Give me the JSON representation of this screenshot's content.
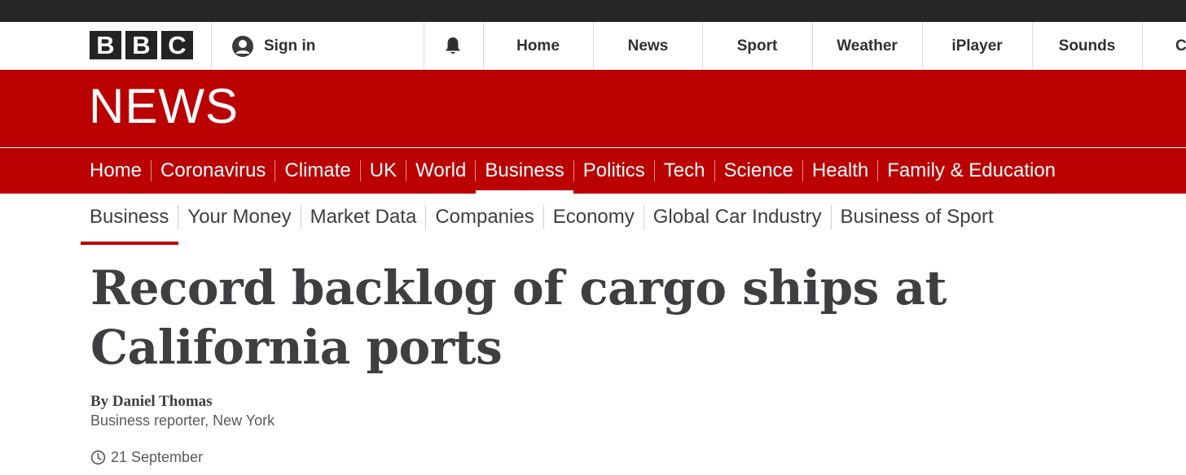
{
  "global_nav": {
    "logo_letters": [
      "B",
      "B",
      "C"
    ],
    "sign_in_label": "Sign in",
    "items": [
      "Home",
      "News",
      "Sport",
      "Weather",
      "iPlayer",
      "Sounds",
      "C"
    ]
  },
  "masthead": {
    "wordmark": "NEWS"
  },
  "section_nav": {
    "items": [
      "Home",
      "Coronavirus",
      "Climate",
      "UK",
      "World",
      "Business",
      "Politics",
      "Tech",
      "Science",
      "Health",
      "Family & Education"
    ],
    "active": "Business"
  },
  "sub_nav": {
    "items": [
      "Business",
      "Your Money",
      "Market Data",
      "Companies",
      "Economy",
      "Global Car Industry",
      "Business of Sport"
    ],
    "active": "Business"
  },
  "article": {
    "headline_line1": "Record backlog of cargo ships at",
    "headline_line2": "California ports",
    "author": "By Daniel Thomas",
    "role": "Business reporter, New York",
    "date": "21 September"
  },
  "colors": {
    "brand_red": "#bb0000",
    "top_strip": "#262626",
    "logo_block": "#232323"
  },
  "icons": {
    "sign_in": "user-avatar-icon",
    "notifications": "bell-icon",
    "date": "clock-icon"
  }
}
